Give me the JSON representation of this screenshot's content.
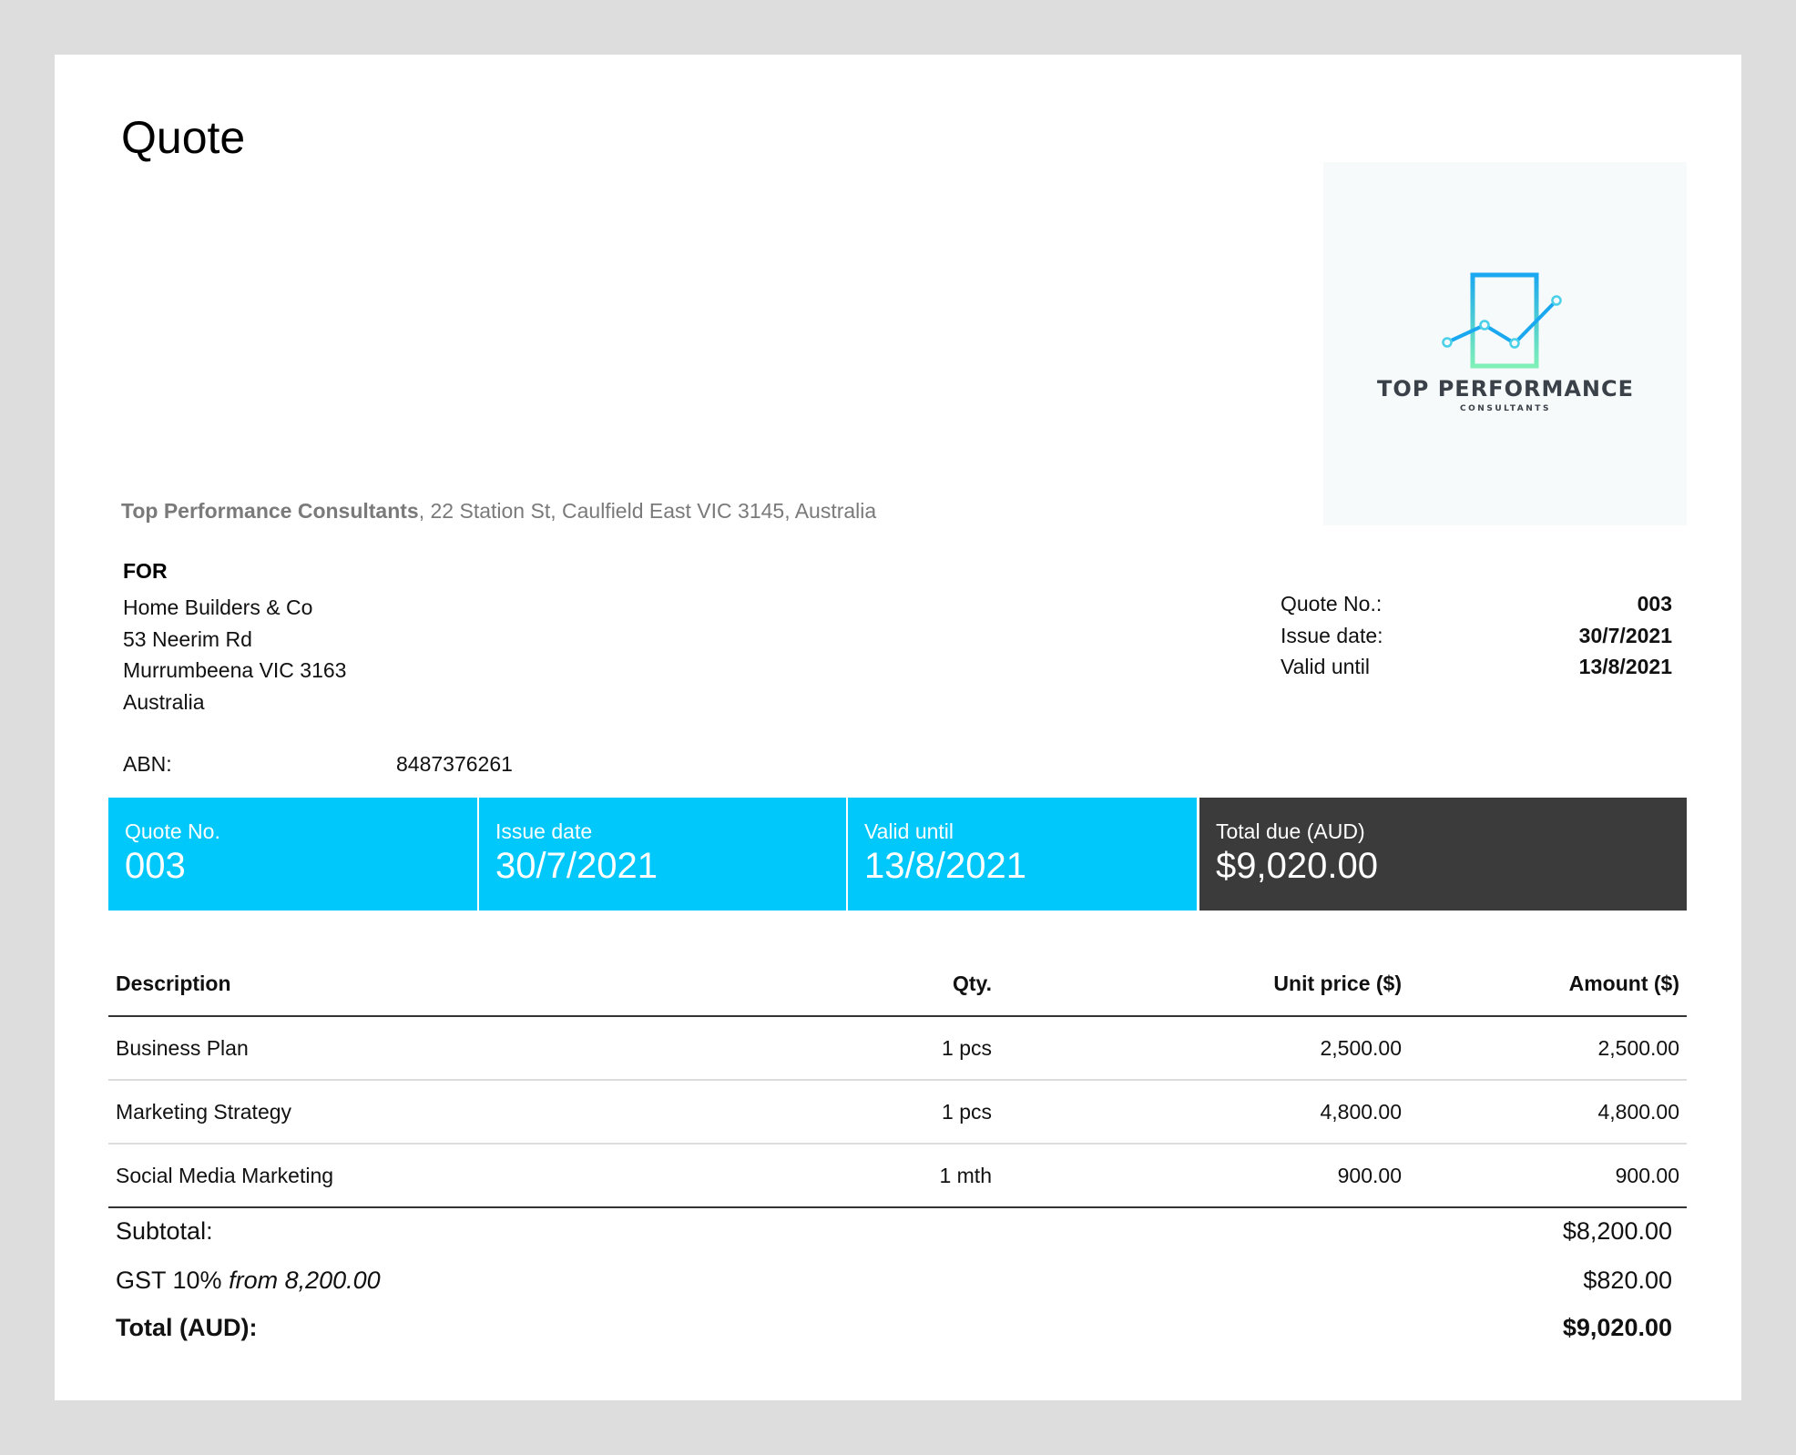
{
  "document": {
    "title": "Quote"
  },
  "logo": {
    "name": "TOP PERFORMANCE",
    "tagline": "CONSULTANTS",
    "colors": {
      "blue": "#1aa8f0",
      "green": "#7ef0b8",
      "text": "#3a4148"
    }
  },
  "sender": {
    "name": "Top Performance Consultants",
    "address": ", 22 Station St, Caulfield East VIC 3145, Australia"
  },
  "client": {
    "label": "FOR",
    "lines": [
      "Home Builders & Co",
      "53 Neerim Rd",
      "Murrumbeena VIC 3163",
      "Australia"
    ],
    "abn_label": "ABN:",
    "abn_value": "8487376261"
  },
  "meta": [
    {
      "label": "Quote No.:",
      "value": "003"
    },
    {
      "label": "Issue date:",
      "value": "30/7/2021"
    },
    {
      "label": "Valid until",
      "value": "13/8/2021"
    }
  ],
  "summary": {
    "colors": {
      "accent": "#00c8fa",
      "dark": "#3b3b3b"
    },
    "cells": [
      {
        "label": "Quote No.",
        "value": "003"
      },
      {
        "label": "Issue date",
        "value": "30/7/2021"
      },
      {
        "label": "Valid until",
        "value": "13/8/2021"
      },
      {
        "label": "Total due (AUD)",
        "value": "$9,020.00"
      }
    ]
  },
  "items": {
    "headers": [
      "Description",
      "Qty.",
      "Unit price ($)",
      "Amount ($)"
    ],
    "rows": [
      {
        "description": "Business Plan",
        "qty": "1 pcs",
        "unit_price": "2,500.00",
        "amount": "2,500.00"
      },
      {
        "description": "Marketing Strategy",
        "qty": "1 pcs",
        "unit_price": "4,800.00",
        "amount": "4,800.00"
      },
      {
        "description": "Social Media Marketing",
        "qty": "1 mth",
        "unit_price": "900.00",
        "amount": "900.00"
      }
    ]
  },
  "totals": {
    "subtotal_label": "Subtotal:",
    "subtotal_value": "$8,200.00",
    "gst_label": "GST 10%",
    "gst_from": "from 8,200.00",
    "gst_value": "$820.00",
    "total_label": "Total (AUD):",
    "total_value": "$9,020.00"
  }
}
